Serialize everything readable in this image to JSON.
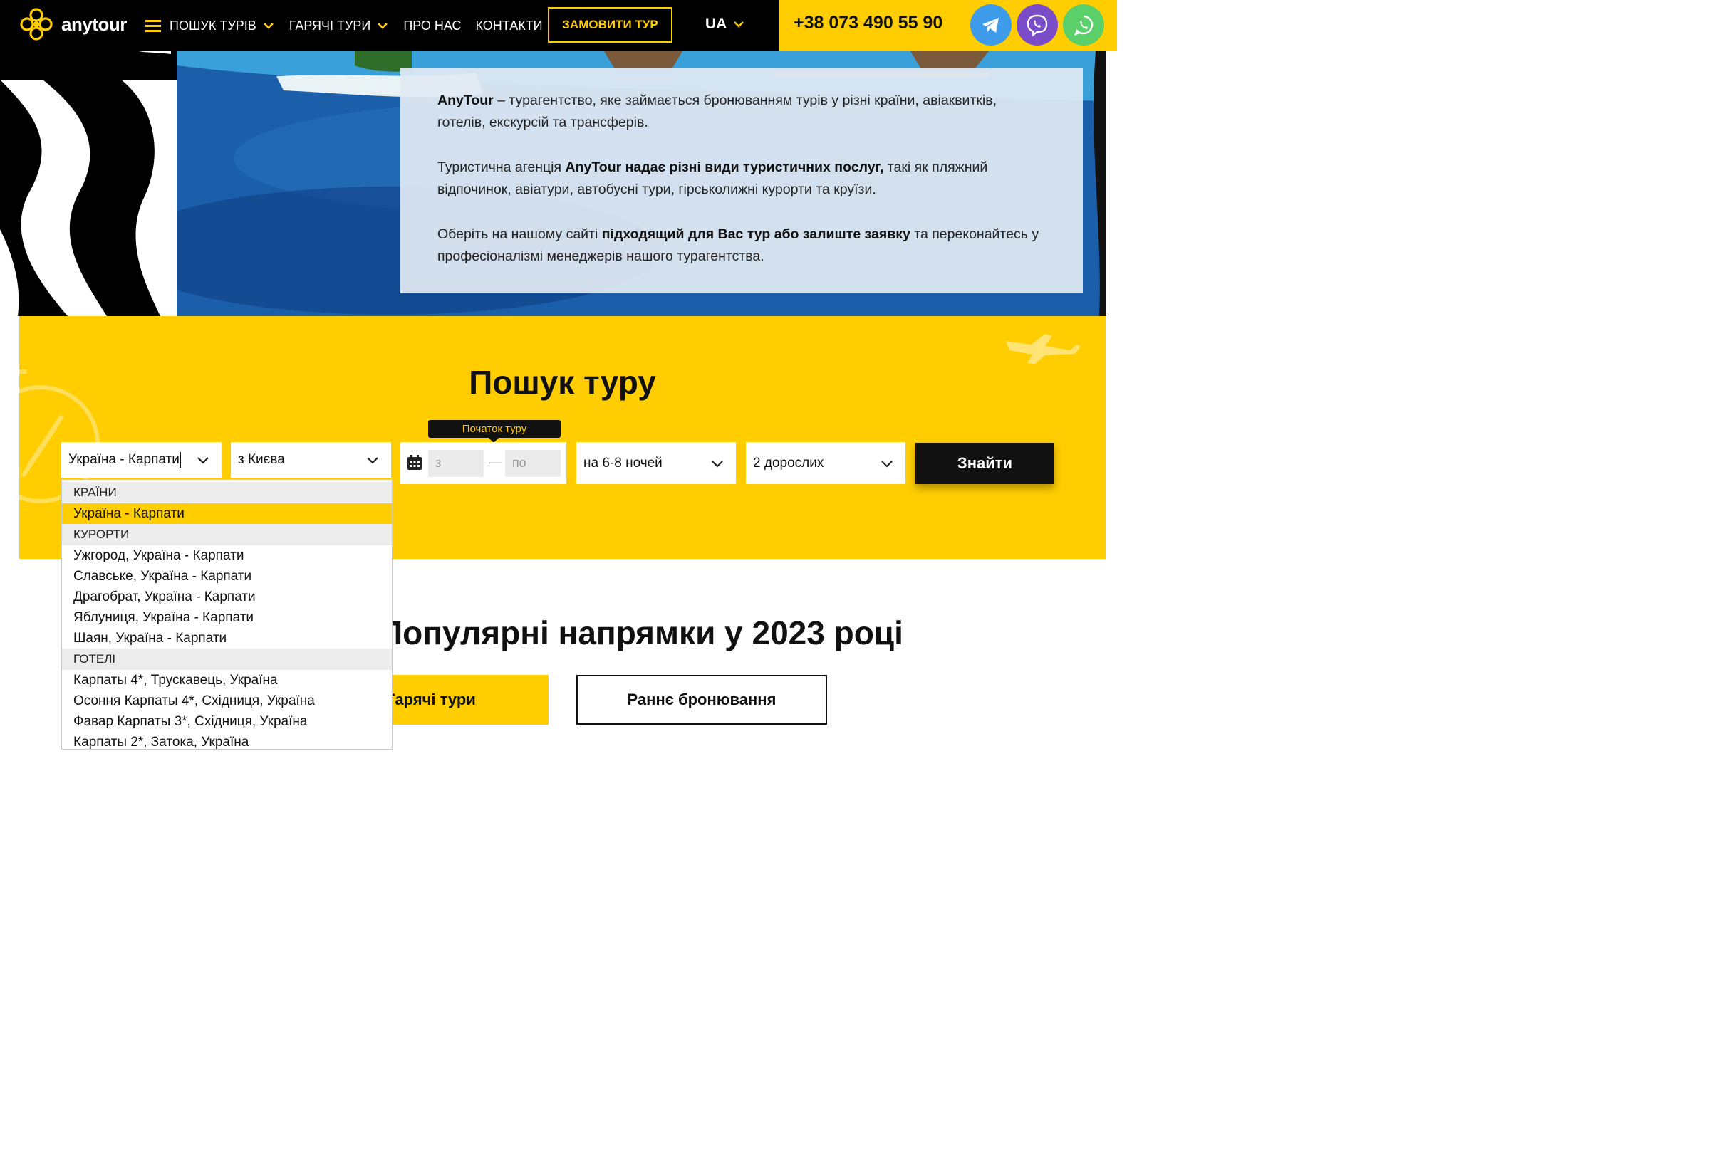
{
  "header": {
    "logo_text": "anytour",
    "nav": [
      {
        "label": "ПОШУК ТУРІВ",
        "has_menu": true
      },
      {
        "label": "ГАРЯЧІ ТУРИ",
        "has_menu": true
      },
      {
        "label": "ПРО НАС",
        "has_menu": false
      },
      {
        "label": "КОНТАКТИ",
        "has_menu": false
      }
    ],
    "order_button": "ЗАМОВИТИ ТУР",
    "language": "UA",
    "phone": "+38 073 490 55 90",
    "social": [
      "telegram-icon",
      "viber-icon",
      "whatsapp-icon"
    ]
  },
  "about": {
    "p1_bold": "AnyTour",
    "p1_text": " – турагентство, яке займається бронюванням турів у різні країни, авіаквитків, готелів, екскурсій та трансферів.",
    "p2_start": "Туристична агенція ",
    "p2_bold": "AnyTour надає різні види туристичних послуг,",
    "p2_end": " такі як пляжний відпочинок, авіатури, автобусні тури, гірськолижні курорти та круїзи.",
    "p3_start": "Оберіть на нашому сайті ",
    "p3_bold": "підходящий для Вас тур або залиште заявку",
    "p3_end": " та переконайтесь у професіоналізмі менеджерів нашого турагентства."
  },
  "search": {
    "title": "Пошук туру",
    "country_value": "Україна - Карпати",
    "from_value": "з Києва",
    "date_tooltip": "Початок туру",
    "date_from_placeholder": "з",
    "date_to_placeholder": "по",
    "date_separator": "—",
    "nights_value": "на 6-8 ночей",
    "people_value": "2 дорослих",
    "submit": "Знайти"
  },
  "dropdown": {
    "countries_header": "КРАЇНИ",
    "countries": [
      "Україна - Карпати"
    ],
    "resorts_header": "КУРОРТИ",
    "resorts": [
      "Ужгород, Україна - Карпати",
      "Славське, Україна - Карпати",
      "Драгобрат, Україна - Карпати",
      "Яблуниця, Україна - Карпати",
      "Шаян, Україна - Карпати"
    ],
    "hotels_header": "ГОТЕЛІ",
    "hotels": [
      "Карпаты 4*, Трускавець, Україна",
      "Осоння Карпаты 4*, Східниця, Україна",
      "Фавар Карпаты 3*, Східниця, Україна",
      "Карпаты 2*, Затока, Україна"
    ]
  },
  "popular": {
    "title": "Популярні напрямки у 2023 році",
    "tab_hot": "Гарячі тури",
    "tab_early": "Раннє бронювання"
  },
  "colors": {
    "accent": "#ffcd00",
    "dark": "#000000"
  }
}
